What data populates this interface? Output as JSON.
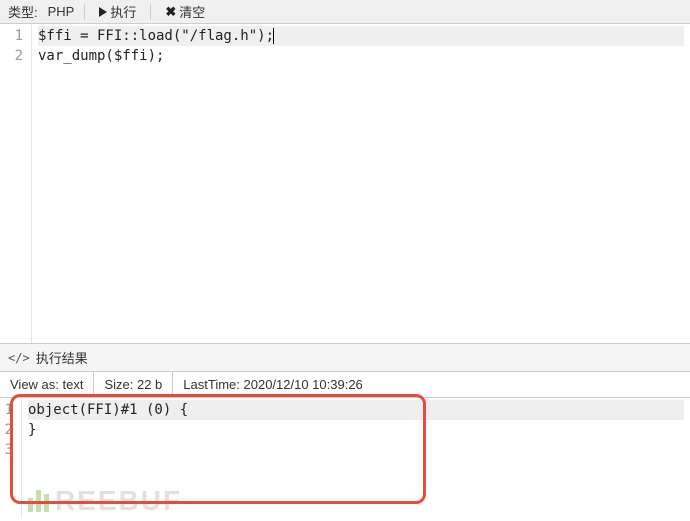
{
  "toolbar": {
    "type_label": "类型:",
    "language": "PHP",
    "run_label": "执行",
    "clear_label": "清空"
  },
  "editor": {
    "lines": [
      "$ffi = FFI::load(\"/flag.h\");",
      "var_dump($ffi);"
    ],
    "line_numbers": [
      "1",
      "2"
    ]
  },
  "result": {
    "header_label": "执行结果",
    "view_as_label": "View as: text",
    "size_label": "Size: 22 b",
    "lasttime_label": "LastTime: 2020/12/10 10:39:26"
  },
  "output": {
    "lines": [
      "object(FFI)#1 (0) {",
      "}",
      ""
    ],
    "line_numbers": [
      "1",
      "2",
      "3"
    ]
  },
  "watermark": {
    "text": "REEBUF"
  }
}
